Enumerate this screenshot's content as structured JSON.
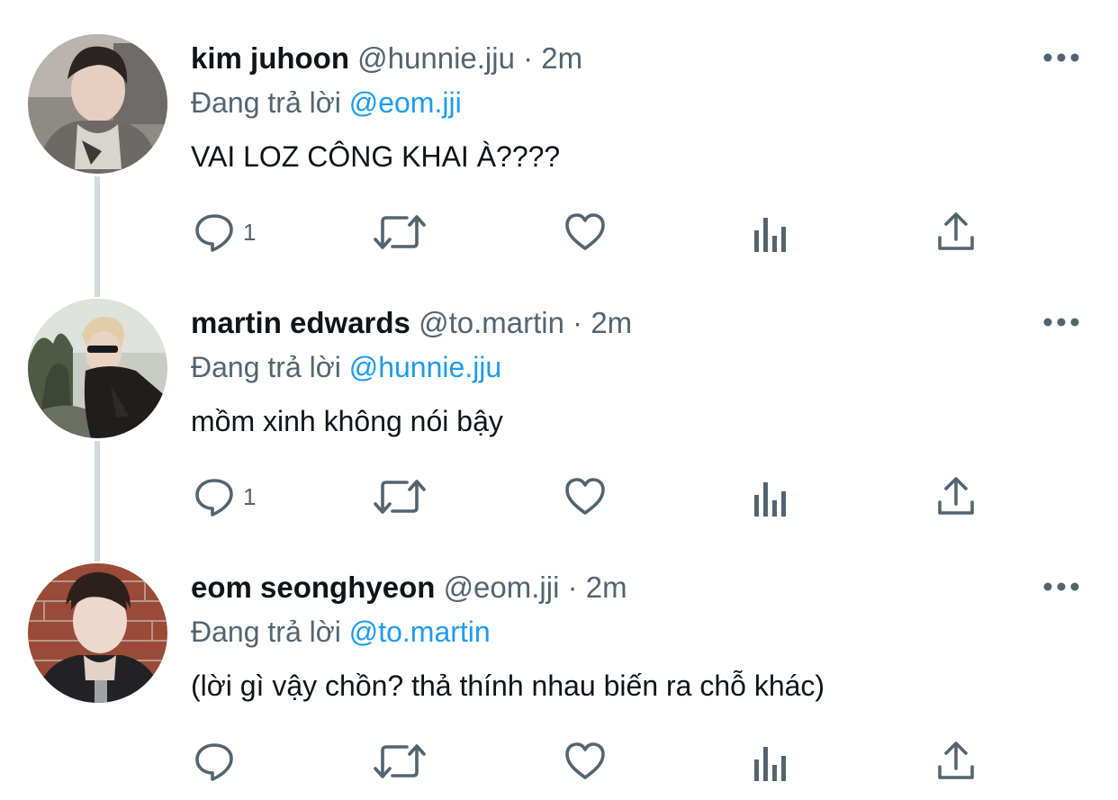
{
  "replying_label": "Đang trả lời",
  "tweets": [
    {
      "name": "kim juhoon",
      "handle": "@hunnie.jju",
      "separator": "·",
      "time": "2m",
      "replying_to": "@eom.jji",
      "text": "VAI LOZ CÔNG KHAI À????",
      "reply_count": "1"
    },
    {
      "name": "martin edwards",
      "handle": "@to.martin",
      "separator": "·",
      "time": "2m",
      "replying_to": "@hunnie.jju",
      "text": "mồm xinh không nói bậy",
      "reply_count": "1"
    },
    {
      "name": "eom seonghyeon",
      "handle": "@eom.jji",
      "separator": "·",
      "time": "2m",
      "replying_to": "@to.martin",
      "text": "(lời gì vậy chồn? thả thính nhau biến ra chỗ khác)",
      "reply_count": ""
    }
  ],
  "icons": {
    "reply": "reply-icon",
    "retweet": "retweet-icon",
    "like": "heart-icon",
    "views": "views-icon",
    "share": "share-icon",
    "more": "more-icon"
  },
  "colors": {
    "text": "#0f1419",
    "secondary": "#536471",
    "mention": "#1d9bf0",
    "thread_line": "#cfd9de"
  }
}
